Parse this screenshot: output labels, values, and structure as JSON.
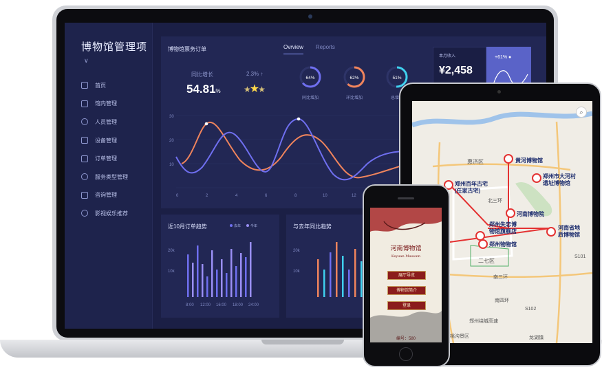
{
  "laptop": {
    "app_title": "博物馆管理项",
    "nav": [
      "首页",
      "馆内管理",
      "人员管理",
      "设备管理",
      "订单管理",
      "服务类型管理",
      "咨询管理",
      "影视娱乐推荐"
    ],
    "main_title": "博物馆票务订单",
    "tabs": [
      "Ovrview",
      "Reports"
    ],
    "stat1": {
      "label": "同比增长",
      "value": "54.81",
      "unit": "%"
    },
    "stat2": {
      "label": "2.3%"
    },
    "rings": [
      {
        "value": "64%",
        "label": "同比增加",
        "pct": 64,
        "color": "#6f6ff0"
      },
      {
        "value": "62%",
        "label": "环比增加",
        "pct": 62,
        "color": "#f0845c"
      },
      {
        "value": "51%",
        "label": "总增加",
        "pct": 51,
        "color": "#3fd0ee"
      }
    ],
    "income": {
      "label": "本月收入",
      "value": "¥2,458",
      "pct": "+61% ●"
    },
    "line_chart": {
      "y_ticks": [
        "30",
        "20",
        "10"
      ],
      "x_ticks": [
        "0",
        "2",
        "4",
        "6",
        "8",
        "10",
        "12"
      ]
    },
    "panel1": {
      "title": "近10月订单趋势",
      "legend": [
        "去年",
        "今年"
      ],
      "y_ticks": [
        "20k",
        "10k"
      ],
      "x_ticks": [
        "8:00",
        "12:00",
        "16:00",
        "18:00",
        "24:00"
      ]
    },
    "panel2": {
      "title": "与去年同比趋势",
      "y_ticks": [
        "20k",
        "10k"
      ]
    }
  },
  "tablet": {
    "labels": {
      "a": "黄河博物馆",
      "b": "郑州市大河村",
      "b2": "遗址博物馆",
      "c": "郑州百年古宅",
      "c2": "(任家古宅)",
      "d": "河南博物院",
      "e": "郑州失恋博",
      "e2": "物馆旗舰店",
      "f": "郑州物物馆",
      "g": "河南省地",
      "g2": "质博物馆",
      "h": "惠济区",
      "i": "北三环",
      "j": "二七区",
      "k": "南三环",
      "l": "南四环",
      "m": "郑州绕城高速",
      "n": "龙湖镇",
      "o": "樱桃沟景区",
      "p": "S102",
      "q": "S101"
    }
  },
  "phone": {
    "logo": "河南博物馆",
    "logo_sub": "Keyuan Museum",
    "buttons": [
      "展厅导览",
      "博物馆简介",
      "登录"
    ],
    "footer": "编号：580"
  }
}
